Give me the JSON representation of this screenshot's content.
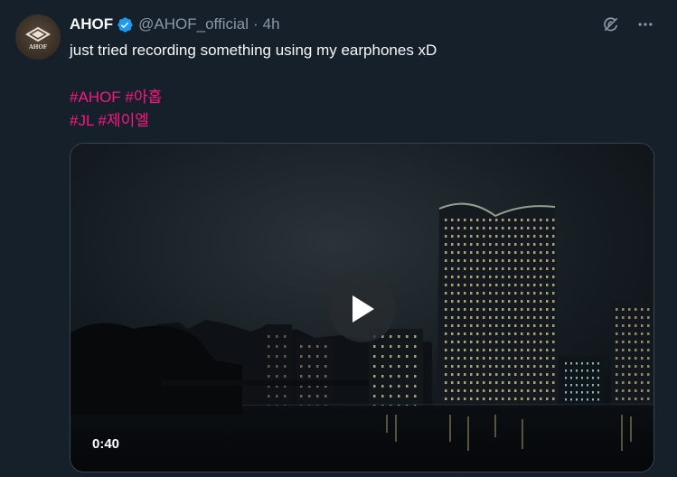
{
  "author": {
    "display_name": "AHOF",
    "handle": "@AHOF_official",
    "separator": "·",
    "time": "4h",
    "avatar_text": "AHOF"
  },
  "tweet": {
    "text_line": "just tried recording something using my earphones xD",
    "hashtags_row1": [
      "#AHOF",
      "#아홉"
    ],
    "hashtags_row2": [
      "#JL",
      "#제이엘"
    ]
  },
  "video": {
    "duration": "0:40"
  },
  "icons": {
    "verified": "verified-badge-icon",
    "grok": "grok-icon",
    "more": "more-icon",
    "play": "play-icon"
  },
  "colors": {
    "background": "#15202b",
    "hashtag": "#f91880",
    "verified": "#1d9bf0",
    "muted": "#8b98a5"
  }
}
